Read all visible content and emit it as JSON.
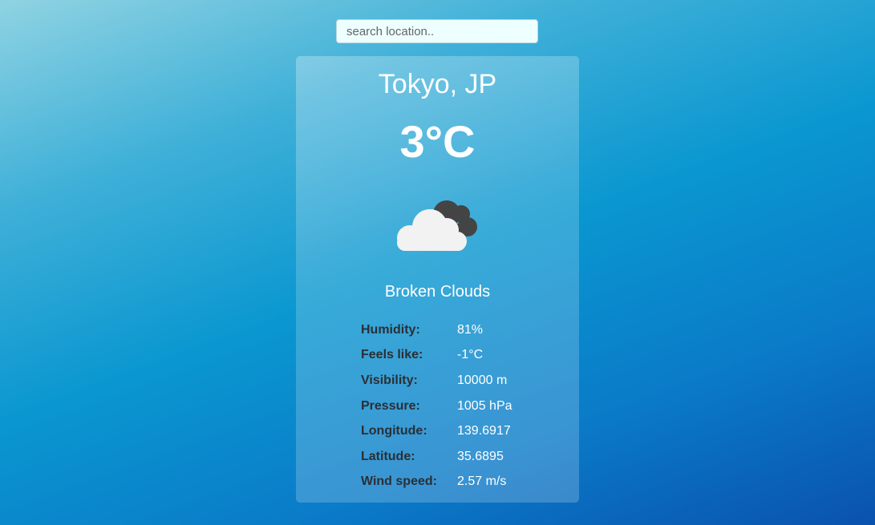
{
  "search": {
    "placeholder": "search location.."
  },
  "weather": {
    "location": "Tokyo, JP",
    "temperature": "3°C",
    "condition_icon": "broken-clouds-icon",
    "description": "Broken Clouds",
    "details": [
      {
        "label": "Humidity:",
        "value": "81%"
      },
      {
        "label": "Feels like:",
        "value": "-1°C"
      },
      {
        "label": "Visibility:",
        "value": "10000 m"
      },
      {
        "label": "Pressure:",
        "value": "1005 hPa"
      },
      {
        "label": "Longitude:",
        "value": "139.6917"
      },
      {
        "label": "Latitude:",
        "value": "35.6895"
      },
      {
        "label": "Wind speed:",
        "value": "2.57 m/s"
      }
    ]
  },
  "colors": {
    "card_text": "#ffffff",
    "label_text": "#2a2f36",
    "cloud_light": "#f2f2f2",
    "cloud_dark": "#444444"
  }
}
